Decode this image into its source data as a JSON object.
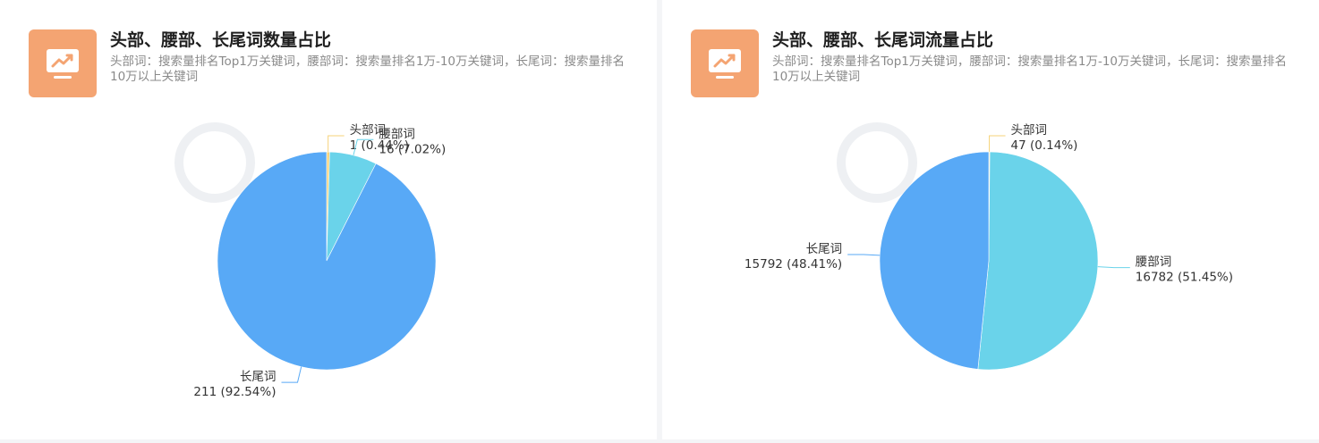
{
  "colors": {
    "head": "#f6d37a",
    "waist": "#6ad3ea",
    "long": "#58a9f6",
    "icon_bg": "#f4a472"
  },
  "icon": "trend-chart-icon",
  "charts": [
    {
      "title": "头部、腰部、长尾词数量占比",
      "subtitle": "头部词：搜索量排名Top1万关键词，腰部词：搜索量排名1万-10万关键词，长尾词：搜索量排名10万以上关键词"
    },
    {
      "title": "头部、腰部、长尾词流量占比",
      "subtitle": "头部词：搜索量排名Top1万关键词，腰部词：搜索量排名1万-10万关键词，长尾词：搜索量排名10万以上关键词"
    }
  ],
  "chart_data": [
    {
      "type": "pie",
      "title": "头部、腰部、长尾词数量占比",
      "slices": [
        {
          "name": "头部词",
          "value": 1,
          "percent": "0.44%",
          "label": "1 (0.44%)"
        },
        {
          "name": "腰部词",
          "value": 16,
          "percent": "7.02%",
          "label": "16 (7.02%)"
        },
        {
          "name": "长尾词",
          "value": 211,
          "percent": "92.54%",
          "label": "211 (92.54%)"
        }
      ]
    },
    {
      "type": "pie",
      "title": "头部、腰部、长尾词流量占比",
      "slices": [
        {
          "name": "头部词",
          "value": 47,
          "percent": "0.14%",
          "label": "47 (0.14%)"
        },
        {
          "name": "腰部词",
          "value": 16782,
          "percent": "51.45%",
          "label": "16782 (51.45%)"
        },
        {
          "name": "长尾词",
          "value": 15792,
          "percent": "48.41%",
          "label": "15792 (48.41%)"
        }
      ]
    }
  ]
}
